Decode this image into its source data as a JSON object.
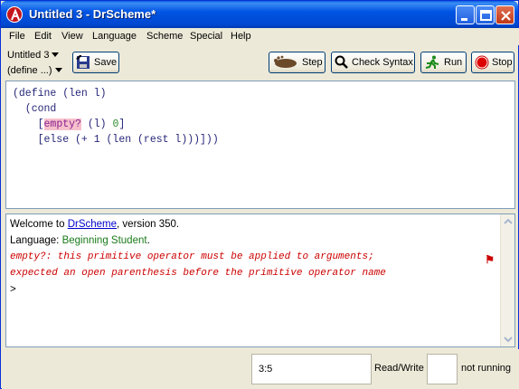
{
  "window": {
    "title": "Untitled 3 - DrScheme*"
  },
  "menu": [
    "File",
    "Edit",
    "View",
    "Language",
    "Scheme",
    "Special",
    "Help"
  ],
  "toolbar": {
    "file_name": "Untitled 3",
    "define_menu": "(define ...)",
    "save_label": "Save",
    "step_label": "Step",
    "check_syntax_label": "Check Syntax",
    "run_label": "Run",
    "stop_label": "Stop"
  },
  "editor": {
    "lines": [
      "(define (len l)",
      "  (cond",
      "    [empty? (l) 0]",
      "    [else (+ 1 (len (rest l)))]))"
    ],
    "highlight": "empty?"
  },
  "repl": {
    "welcome_prefix": "Welcome to ",
    "welcome_link": "DrScheme",
    "welcome_suffix": ", version 350.",
    "language_prefix": "Language: ",
    "language_value": "Beginning Student",
    "language_suffix": ".",
    "error_line1": "empty?: this primitive operator must be applied to arguments;",
    "error_line2": "expected an open parenthesis before the primitive operator name",
    "prompt": ">"
  },
  "status": {
    "position": "3:5",
    "mode": "Read/Write",
    "running": "not running"
  },
  "colors": {
    "titlebar": "#0054e3",
    "error_text": "#cc0000",
    "language_text": "#1a7a1a",
    "highlight_bg": "#f6c0cc"
  }
}
